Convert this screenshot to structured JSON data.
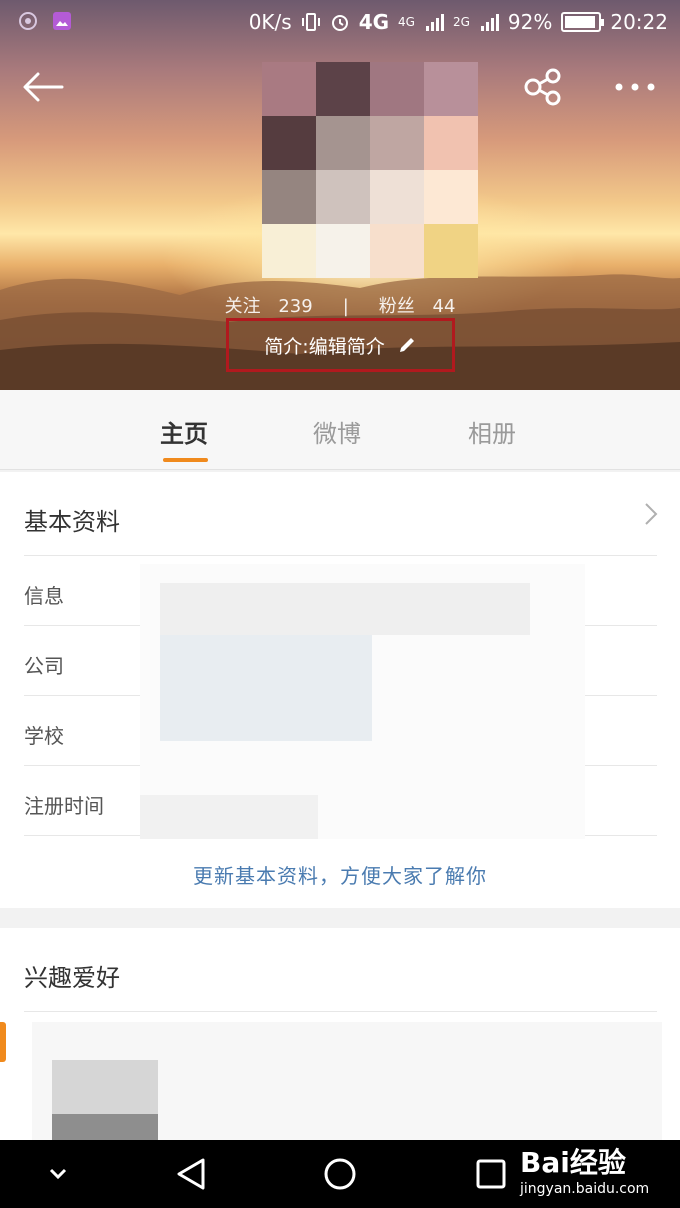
{
  "status_bar": {
    "speed": "0K/s",
    "network_1": "4G",
    "network_2": "4G",
    "network_3": "2G",
    "battery_text": "92%",
    "battery_level": 0.92,
    "time": "20:22"
  },
  "profile": {
    "following_label": "关注",
    "following_count": "239",
    "separator": "|",
    "followers_label": "粉丝",
    "followers_count": "44",
    "intro_text": "简介:编辑简介"
  },
  "tabs": [
    {
      "label": "主页",
      "active": true
    },
    {
      "label": "微博",
      "active": false
    },
    {
      "label": "相册",
      "active": false
    }
  ],
  "basic_info": {
    "title": "基本资料",
    "rows": [
      {
        "label": "信息"
      },
      {
        "label": "公司"
      },
      {
        "label": "学校"
      },
      {
        "label": "注册时间"
      }
    ],
    "update_link": "更新基本资料，方便大家了解你"
  },
  "hobbies": {
    "title": "兴趣爱好"
  },
  "watermark": {
    "brand": "Bai经验",
    "url": "jingyan.baidu.com"
  },
  "colors": {
    "accent_orange": "#f08a1d",
    "highlight_red": "#b1191e",
    "link_blue": "#4a7bb0"
  },
  "icons": [
    "back-arrow-icon",
    "share-icon",
    "more-icon",
    "pencil-icon",
    "chevron-right-icon",
    "nav-down-icon",
    "nav-back-icon",
    "nav-home-icon",
    "nav-recent-icon"
  ]
}
